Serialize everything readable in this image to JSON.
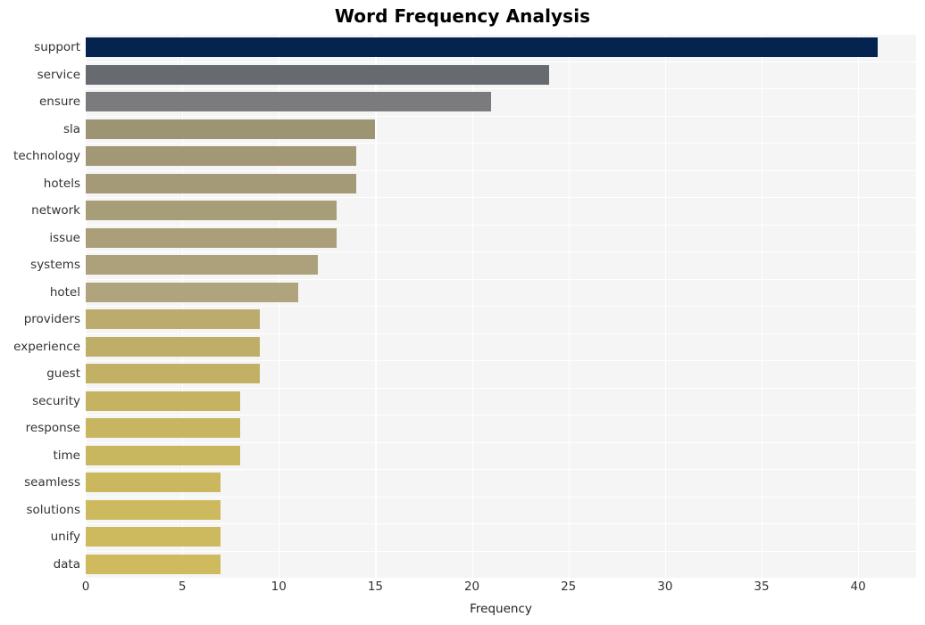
{
  "chart_data": {
    "type": "bar",
    "orientation": "horizontal",
    "title": "Word Frequency Analysis",
    "xlabel": "Frequency",
    "ylabel": "",
    "categories": [
      "support",
      "service",
      "ensure",
      "sla",
      "technology",
      "hotels",
      "network",
      "issue",
      "systems",
      "hotel",
      "providers",
      "experience",
      "guest",
      "security",
      "response",
      "time",
      "seamless",
      "solutions",
      "unify",
      "data"
    ],
    "values": [
      41,
      24,
      21,
      15,
      14,
      14,
      13,
      13,
      12,
      11,
      9,
      9,
      9,
      8,
      8,
      8,
      7,
      7,
      7,
      7
    ],
    "xticks": [
      0,
      5,
      10,
      15,
      20,
      25,
      30,
      35,
      40
    ],
    "xlim": [
      0,
      43
    ],
    "grid": true,
    "legend": false,
    "bar_colors": [
      "#04234f",
      "#686a72",
      "#7b7b7d",
      "#9d9473",
      "#a29876",
      "#a59a77",
      "#a89d79",
      "#ab9f7a",
      "#ada17c",
      "#b0a47d",
      "#bbac6e",
      "#bfae68",
      "#c2b165",
      "#c5b362",
      "#c7b560",
      "#c9b75f",
      "#cbb85e",
      "#cdba5e",
      "#ceba5e",
      "#cfbb5e"
    ],
    "plot_background": "#f5f5f6",
    "grid_color": "#ffffff",
    "figure_background": "#ffffff",
    "title_color": "#000000",
    "tick_label_color": "#333333"
  }
}
